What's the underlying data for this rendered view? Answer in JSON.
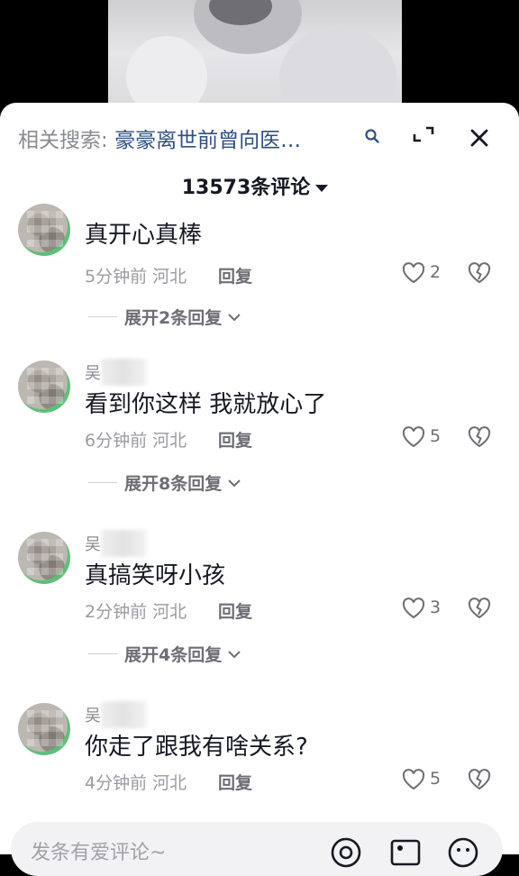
{
  "related_search": {
    "prefix": "相关搜索:",
    "query": "豪豪离世前曾向医…"
  },
  "comments_header": {
    "count_label": "13573条评论"
  },
  "comments": [
    {
      "username": "",
      "text": "真开心真棒",
      "meta": "5分钟前 河北",
      "reply_label": "回复",
      "likes": "2",
      "expand_label": "展开2条回复"
    },
    {
      "username": "吴",
      "text": "看到你这样 我就放心了",
      "meta": "6分钟前 河北",
      "reply_label": "回复",
      "likes": "5",
      "expand_label": "展开8条回复"
    },
    {
      "username": "吴",
      "text": "真搞笑呀小孩",
      "meta": "2分钟前 河北",
      "reply_label": "回复",
      "likes": "3",
      "expand_label": "展开4条回复"
    },
    {
      "username": "吴",
      "text": "你走了跟我有啥关系?",
      "meta": "4分钟前 河北",
      "reply_label": "回复",
      "likes": "5",
      "expand_label": ""
    }
  ],
  "comment_input": {
    "placeholder": "发条有爱评论~"
  },
  "icons": [
    "search-icon",
    "expand-icon",
    "close-icon",
    "heart-icon",
    "broken-heart-icon",
    "chevron-down-icon",
    "at-icon",
    "image-icon",
    "emoji-icon"
  ],
  "colors": {
    "accent_link": "#2f4f86",
    "text_primary": "#161823",
    "text_secondary": "#8a8b91"
  }
}
